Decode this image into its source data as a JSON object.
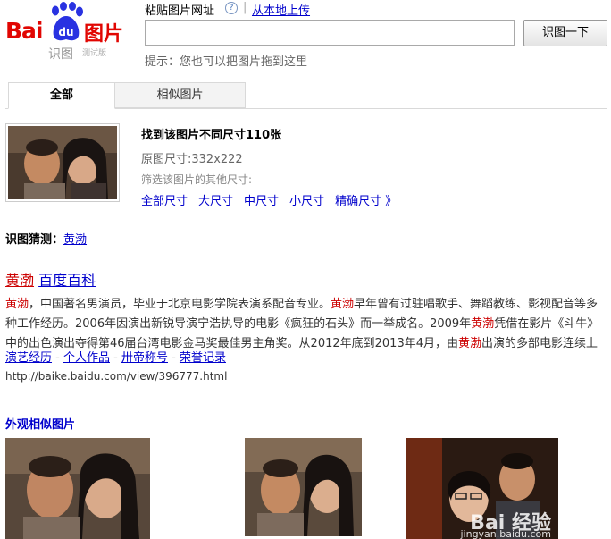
{
  "logo": {
    "brand_left": "Bai",
    "brand_paw": "du",
    "brand_right": "图片",
    "sub": "识图",
    "beta": "测试版"
  },
  "header": {
    "paste_url_label": "粘贴图片网址",
    "help_icon": "?",
    "separator": "|",
    "upload_local_link": "从本地上传",
    "input_value": "",
    "search_button": "识图一下",
    "hint": "提示：您也可以把图片拖到这里"
  },
  "tabs": [
    {
      "label": "全部",
      "active": true
    },
    {
      "label": "相似图片",
      "active": false
    }
  ],
  "result": {
    "found_text": "找到该图片不同尺寸110张",
    "original_size": "原图尺寸:332x222",
    "filter_label": "筛选该图片的其他尺寸:",
    "sizes": [
      "全部尺寸",
      "大尺寸",
      "中尺寸",
      "小尺寸",
      "精确尺寸 》"
    ]
  },
  "guess": {
    "label": "识图猜测：",
    "value": "黄渤"
  },
  "baike": {
    "title_name": "黄渤",
    "title_suffix": "百度百科",
    "body": [
      {
        "t": "黄渤",
        "hl": true
      },
      {
        "t": "，中国著名男演员，毕业于北京电影学院表演系配音专业。",
        "hl": false
      },
      {
        "t": "黄渤",
        "hl": true
      },
      {
        "t": "早年曾有过驻唱歌手、舞蹈教练、影视配音等多种工作经历。2006年因演出新锐导演宁浩执导的电影《疯狂的石头》而一举成名。2009年",
        "hl": false
      },
      {
        "t": "黄渤",
        "hl": true
      },
      {
        "t": "凭借在影片《斗牛》中的出色演出夺得第46届台湾电影金马奖最佳男主角奖。从2012年底到2013年4月，由",
        "hl": false
      },
      {
        "t": "黄渤",
        "hl": true
      },
      {
        "t": "出演的多部电影连续上",
        "hl": false
      }
    ],
    "links": [
      "演艺经历",
      "个人作品",
      "卅帝称号",
      "荣誉记录"
    ],
    "link_sep": " - ",
    "url": "http://baike.baidu.com/view/396777.html"
  },
  "similar": {
    "heading": "外观相似图片",
    "watermark": "Bai 经验",
    "watermark_url": "jingyan.baidu.com"
  },
  "colors": {
    "brand_red": "#e10602",
    "link_blue": "#0000cc",
    "highlight_red": "#cc0000"
  }
}
